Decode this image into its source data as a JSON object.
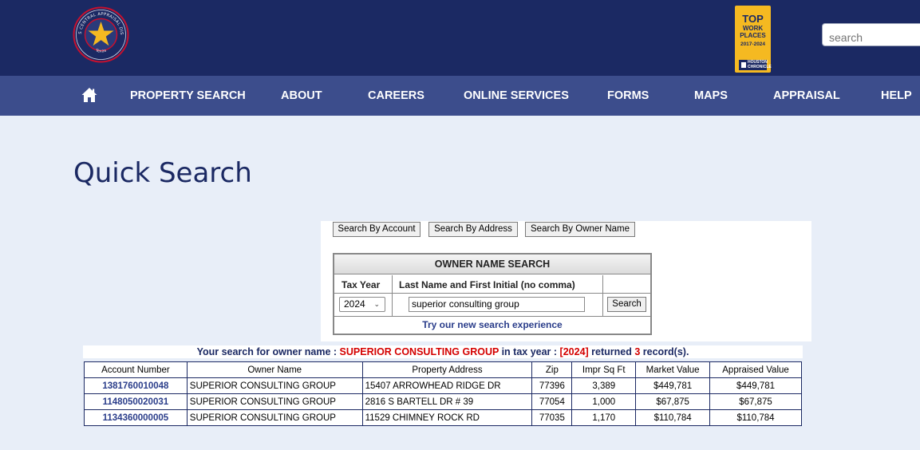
{
  "header": {
    "logo_text_top": "HARRIS CENTRAL APPRAISAL DISTRICT",
    "logo_text_bottom": "Texas",
    "badge": {
      "line1": "TOP",
      "line2": "WORK\nPLACES",
      "years": "2017-2024",
      "sponsor": "HOUSTON\nCHRONICLE"
    },
    "search_placeholder": "search"
  },
  "nav": {
    "items": [
      {
        "id": "property-search",
        "label": "PROPERTY SEARCH"
      },
      {
        "id": "about",
        "label": "ABOUT"
      },
      {
        "id": "careers",
        "label": "CAREERS"
      },
      {
        "id": "online-services",
        "label": "ONLINE SERVICES"
      },
      {
        "id": "forms",
        "label": "FORMS"
      },
      {
        "id": "maps",
        "label": "MAPS"
      },
      {
        "id": "appraisal",
        "label": "APPRAISAL"
      },
      {
        "id": "help",
        "label": "HELP"
      }
    ]
  },
  "page": {
    "title": "Quick Search"
  },
  "search_tabs": [
    {
      "id": "by-account",
      "label": "Search By Account"
    },
    {
      "id": "by-address",
      "label": "Search By Address"
    },
    {
      "id": "by-owner",
      "label": "Search By Owner Name"
    }
  ],
  "owner_search": {
    "heading": "OWNER NAME SEARCH",
    "tax_year_label": "Tax Year",
    "name_label": "Last Name and First Initial (no comma)",
    "tax_year_value": "2024",
    "name_value": "superior consulting group",
    "search_button": "Search",
    "try_new_link": "Try our new search experience"
  },
  "summary": {
    "prefix": "Your search for owner name : ",
    "owner": "SUPERIOR CONSULTING GROUP",
    "middle": " in tax year : ",
    "year": "[2024]",
    "returned": " returned ",
    "count": "3",
    "suffix": " record(s)."
  },
  "results": {
    "columns": [
      "Account Number",
      "Owner Name",
      "Property Address",
      "Zip",
      "Impr Sq Ft",
      "Market Value",
      "Appraised Value"
    ],
    "rows": [
      [
        "1381760010048",
        "SUPERIOR CONSULTING GROUP",
        "15407 ARROWHEAD RIDGE DR",
        "77396",
        "3,389",
        "$449,781",
        "$449,781"
      ],
      [
        "1148050020031",
        "SUPERIOR CONSULTING GROUP",
        "2816 S BARTELL DR # 39",
        "77054",
        "1,000",
        "$67,875",
        "$67,875"
      ],
      [
        "1134360000005",
        "SUPERIOR CONSULTING GROUP",
        "11529 CHIMNEY ROCK RD",
        "77035",
        "1,170",
        "$110,784",
        "$110,784"
      ]
    ]
  },
  "colors": {
    "header_bg": "#1b2963",
    "nav_bg": "#3c4d8c",
    "page_bg": "#e8eef8",
    "link": "#2a3d8a",
    "highlight_red": "#d40000",
    "badge_gold": "#f5b921"
  },
  "icons": {
    "home": "home-icon",
    "logo_star": "star-icon",
    "select_chevron": "chevron-down-icon"
  }
}
